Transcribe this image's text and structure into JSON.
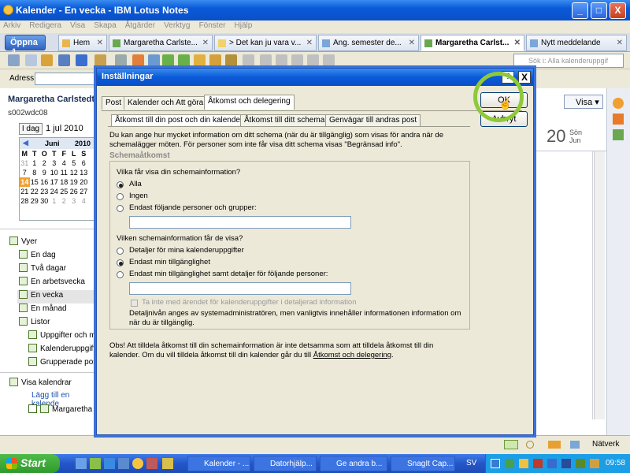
{
  "window": {
    "title": "Kalender - En vecka - IBM Lotus Notes",
    "min": "_",
    "max": "□",
    "close": "X"
  },
  "menu": [
    "Arkiv",
    "Redigera",
    "Visa",
    "Skapa",
    "Åtgärder",
    "Verktyg",
    "Fönster",
    "Hjälp"
  ],
  "tabs": {
    "open_label": "Öppna",
    "items": [
      {
        "label": "Hem",
        "active": false
      },
      {
        "label": "Margaretha Carlste...",
        "active": false
      },
      {
        "label": "> Det kan ju vara v...",
        "active": false
      },
      {
        "label": "Ang. semester de...",
        "active": false
      },
      {
        "label": "Margaretha Carlst...",
        "active": true
      },
      {
        "label": "Nytt meddelande",
        "active": false
      }
    ]
  },
  "toolbar": {
    "search_placeholder": "Sök i: Alla kalenderuppgif"
  },
  "address": {
    "label": "Adress"
  },
  "left": {
    "owner_name": "Margaretha Carlstedt",
    "owner_id": "s002wdc08",
    "day_button": "I dag",
    "date_label": "1 jul 2010",
    "minical": {
      "month": "Juni",
      "year": "2010",
      "weekdays": [
        "M",
        "T",
        "O",
        "T",
        "F",
        "L",
        "S"
      ],
      "weeks": [
        [
          "31",
          "1",
          "2",
          "3",
          "4",
          "5",
          "6"
        ],
        [
          "7",
          "8",
          "9",
          "10",
          "11",
          "12",
          "13"
        ],
        [
          "14",
          "15",
          "16",
          "17",
          "18",
          "19",
          "20"
        ],
        [
          "21",
          "22",
          "23",
          "24",
          "25",
          "26",
          "27"
        ],
        [
          "28",
          "29",
          "30",
          "1",
          "2",
          "3",
          "4"
        ]
      ]
    },
    "views_header": "Vyer",
    "views": [
      "En dag",
      "Två dagar",
      "En arbetsvecka",
      "En vecka",
      "En månad"
    ],
    "lists_header": "Listor",
    "lists": [
      "Uppgifter och m",
      "Kalenderuppgift",
      "Grupperade pos"
    ],
    "show_calendars": "Visa kalendrar",
    "add_calendar": "Lägg till en kalende",
    "calendar_entry": "Margaretha C"
  },
  "right": {
    "vis_button": "Visa",
    "day_number": "20",
    "day_name": "Sön",
    "day_month": "Jun"
  },
  "dialog": {
    "title": "Inställningar",
    "help": "?",
    "close": "X",
    "ok": "OK",
    "cancel": "Avbryt",
    "tabs": [
      "Post",
      "Kalender och Att göra",
      "Åtkomst och delegering"
    ],
    "subtabs": [
      "Åtkomst till din post och din kalender",
      "Åtkomst till ditt schema",
      "Genvägar till andras post"
    ],
    "intro": "Du kan ange hur mycket information om ditt schema (när du är tillgänglig) som visas för andra när de schemalägger möten.  För personer som inte får visa ditt schema visas \"Begränsad info\".",
    "group_title": "Schemaåtkomst",
    "q1": "Vilka får visa din schemainformation?",
    "q1_options": [
      "Alla",
      "Ingen",
      "Endast följande personer och grupper:"
    ],
    "q2": "Vilken schemainformation får de visa?",
    "q2_options": [
      "Detaljer för mina kalenderuppgifter",
      "Endast min tillgänglighet",
      "Endast min tillgänglighet samt detaljer för följande personer:"
    ],
    "checkbox_label": "Ta inte med ärendet för kalenderuppgifter i detaljerad information",
    "detail_note": "Detaljnivån anges av systemadministratören, men vanligtvis innehåller informationen information om när du är tillgänglig.",
    "footer_text": "Obs! Att tilldela åtkomst till din schemainformation är inte detsamma som att tilldela åtkomst till din kalender.  Om du vill tilldela åtkomst till din kalender går du till ",
    "footer_link": "Åtkomst och delegering",
    "footer_end": "."
  },
  "status": {
    "network": "Nätverk"
  },
  "taskbar": {
    "start": "Start",
    "items": [
      "Kalender - ...",
      "Datorhjälp...",
      "Ge andra b...",
      "SnagIt Cap..."
    ],
    "lang": "SV",
    "clock": "09:58"
  },
  "colors": {
    "xp_blue": "#0a5ad8",
    "highlight_ring": "#8fc93a",
    "today": "#f0a030"
  }
}
